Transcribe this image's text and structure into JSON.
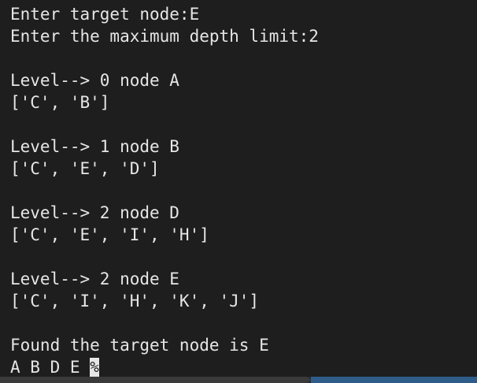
{
  "terminal": {
    "lines": [
      "Enter target node:E",
      "Enter the maximum depth limit:2",
      "",
      "Level--> 0 node A",
      "['C', 'B']",
      "",
      "Level--> 1 node B",
      "['C', 'E', 'D']",
      "",
      "Level--> 2 node D",
      "['C', 'E', 'I', 'H']",
      "",
      "Level--> 2 node E",
      "['C', 'I', 'H', 'K', 'J']",
      "",
      "Found the target node is E"
    ],
    "final_output": "A B D E ",
    "cursor_char": "%"
  },
  "colors": {
    "background": "#1e1e1e",
    "foreground": "#e6e6e6"
  }
}
